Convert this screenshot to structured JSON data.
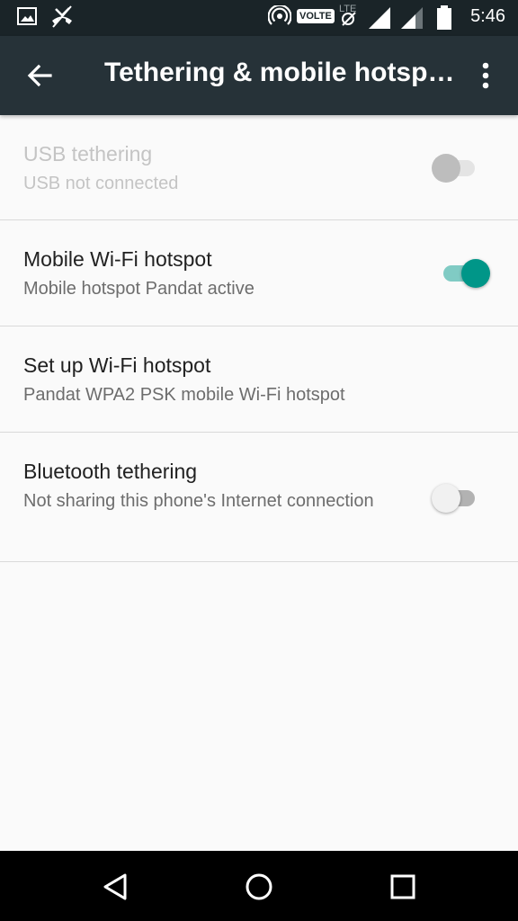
{
  "status_bar": {
    "time": "5:46",
    "volte_label": "VOLTE",
    "lte_label": "LTE",
    "icons": [
      "image-icon",
      "missed-call-icon",
      "hotspot-icon",
      "mute-icon",
      "signal-icon",
      "signal-icon-2",
      "battery-icon"
    ]
  },
  "app_bar": {
    "title": "Tethering & mobile hotsp…",
    "back_icon": "arrow-left-icon",
    "more_icon": "more-vert-icon"
  },
  "settings": [
    {
      "id": "usb-tethering",
      "title": "USB tethering",
      "summary": "USB not connected",
      "switch": "off",
      "enabled": false
    },
    {
      "id": "wifi-hotspot",
      "title": "Mobile Wi-Fi hotspot",
      "summary": "Mobile hotspot Pandat active",
      "switch": "on",
      "enabled": true
    },
    {
      "id": "setup-hotspot",
      "title": "Set up Wi-Fi hotspot",
      "summary": "Pandat WPA2 PSK mobile Wi-Fi hotspot",
      "enabled": true
    },
    {
      "id": "bluetooth-tethering",
      "title": "Bluetooth tethering",
      "summary": "Not sharing this phone's Internet connection",
      "switch": "off",
      "enabled": true
    }
  ],
  "colors": {
    "app_bar": "#263238",
    "status_bar": "#1a2428",
    "accent": "#009688",
    "accent_track": "#80cbc4",
    "switch_off_thumb": "#f1f1f1",
    "switch_off_track": "#b2b2b2"
  },
  "nav_bar": {
    "back": "nav-back-icon",
    "home": "nav-home-icon",
    "recents": "nav-recents-icon"
  }
}
